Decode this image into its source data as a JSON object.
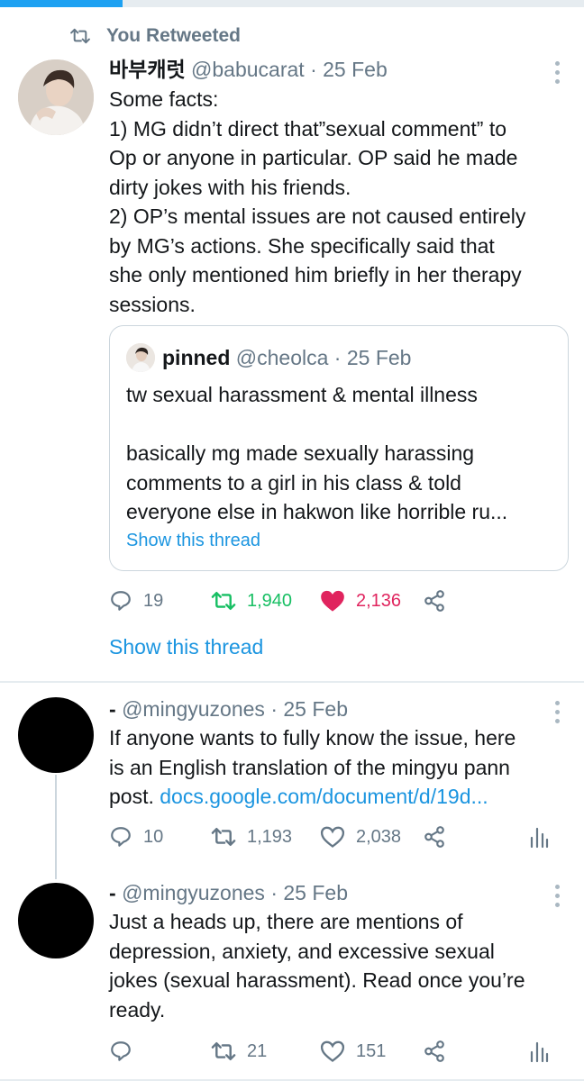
{
  "colors": {
    "accent": "#1da1f2",
    "link": "#1b95e0",
    "retweet_green": "#17bf63",
    "like_pink": "#e0245e",
    "muted": "#657786"
  },
  "top_progress": {
    "fraction": 0.21
  },
  "retweeted_banner": {
    "icon": "retweet-icon",
    "label": "You Retweeted"
  },
  "tweet1": {
    "display_name": "바부캐럿",
    "handle": "@babucarat",
    "date": "· 25 Feb",
    "lines": [
      "Some facts:",
      "1) MG didn’t direct that”sexual comment” to",
      "Op or anyone in particular. OP said he made",
      "dirty jokes with his friends.",
      "2) OP’s mental issues are not caused entirely",
      "by MG’s actions. She specifically said that",
      "she only mentioned him briefly in her therapy",
      "sessions."
    ],
    "quote": {
      "display_name": "pinned",
      "handle": "@cheolca",
      "date": "· 25 Feb",
      "lines": [
        "tw sexual harassment & mental illness",
        "",
        "basically mg made sexually harassing",
        "comments to a girl in his class & told",
        "everyone else in hakwon like horrible ru..."
      ],
      "show_thread": "Show this thread"
    },
    "actions": {
      "replies": "19",
      "retweets": "1,940",
      "likes": "2,136"
    },
    "show_thread": "Show this thread"
  },
  "tweet2": {
    "display_name": "-",
    "handle": "@mingyuzones",
    "date": "· 25 Feb",
    "lines_plain": [
      "If anyone wants to fully know the issue, here",
      "is an English translation of the mingyu pann"
    ],
    "line3_prefix": "post. ",
    "line3_link": "docs.google.com/document/d/19d...",
    "actions": {
      "replies": "10",
      "retweets": "1,193",
      "likes": "2,038"
    }
  },
  "tweet3": {
    "display_name": "-",
    "handle": "@mingyuzones",
    "date": "· 25 Feb",
    "lines": [
      "Just a heads up, there are mentions of",
      "depression, anxiety, and excessive sexual",
      "jokes (sexual harassment). Read once you’re",
      "ready."
    ],
    "actions": {
      "replies": "",
      "retweets": "21",
      "likes": "151"
    }
  }
}
